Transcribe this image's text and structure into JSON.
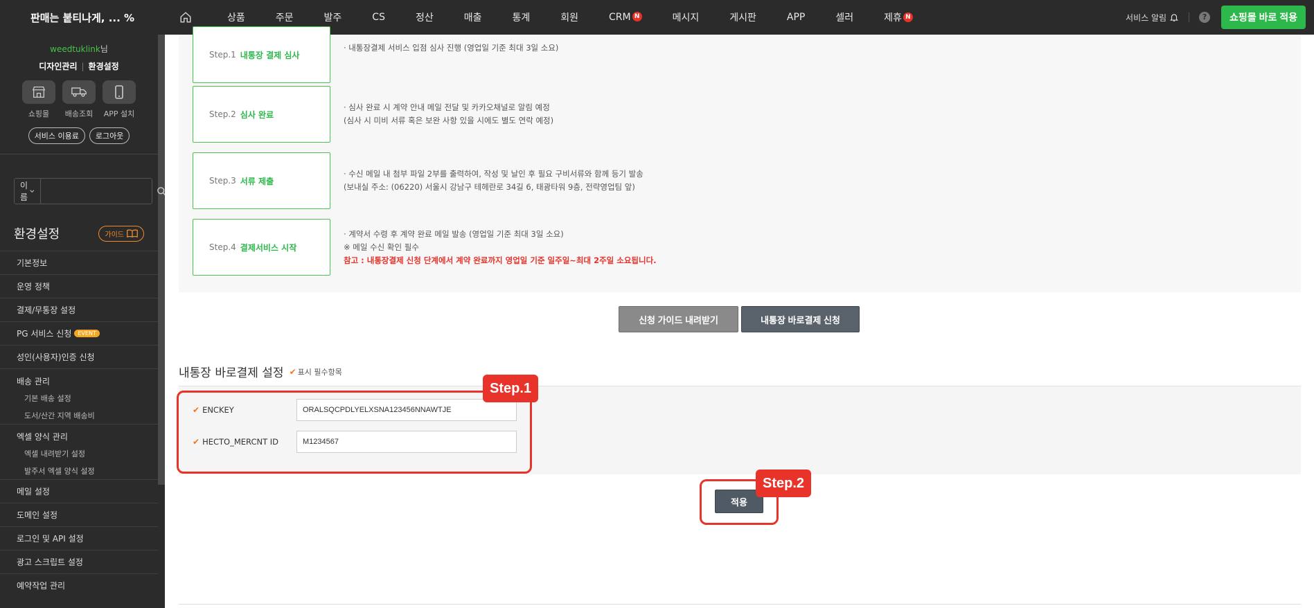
{
  "topbar": {
    "brand": "판매는 붙티나게, ... %",
    "nav": [
      {
        "label": "상품",
        "badge": ""
      },
      {
        "label": "주문",
        "badge": ""
      },
      {
        "label": "발주",
        "badge": ""
      },
      {
        "label": "CS",
        "badge": ""
      },
      {
        "label": "정산",
        "badge": ""
      },
      {
        "label": "매출",
        "badge": ""
      },
      {
        "label": "통계",
        "badge": ""
      },
      {
        "label": "회원",
        "badge": ""
      },
      {
        "label": "CRM",
        "badge": "N"
      },
      {
        "label": "메시지",
        "badge": ""
      },
      {
        "label": "게시판",
        "badge": ""
      },
      {
        "label": "APP",
        "badge": ""
      },
      {
        "label": "셀러",
        "badge": ""
      },
      {
        "label": "제휴",
        "badge": "N"
      }
    ],
    "alarm_label": "서비스 알림",
    "help_label": "?",
    "apply_shop_label": "쇼핑몰 바로 적용"
  },
  "sidebar": {
    "username": "weedtuklink",
    "honorific": "님",
    "links": [
      "디자인관리",
      "환경설정"
    ],
    "quick": [
      {
        "label": "쇼핑몰",
        "icon": "store-icon"
      },
      {
        "label": "배송조회",
        "icon": "truck-icon"
      },
      {
        "label": "APP 설치",
        "icon": "phone-icon"
      }
    ],
    "pills": [
      "서비스 이용료",
      "로그아웃"
    ],
    "search_select": "이름",
    "search_placeholder": "",
    "settings_title": "환경설정",
    "guide_label": "가이드",
    "menu": {
      "basic_info": "기본정보",
      "policy": "운영 정책",
      "payment": "결제/무통장 설정",
      "pg": "PG 서비스 신청",
      "pg_badge": "EVENT",
      "adult": "성인(사용자)인증 신청",
      "delivery": "배송 관리",
      "delivery_basic": "기본 배송 설정",
      "delivery_island": "도서/산간 지역 배송비",
      "excel": "엑셀 양식 관리",
      "excel_download": "엑셀 내려받기 설정",
      "excel_order": "발주서 엑셀 양식 설정",
      "mail": "메일 설정",
      "domain": "도메인 설정",
      "login_api": "로그인 및 API 설정",
      "ad_script": "광고 스크립트 설정",
      "reservation": "예약작업 관리"
    }
  },
  "steps": [
    {
      "num": "Step.1",
      "name": "내통장 결제 심사",
      "desc": [
        "· 내통장결제 서비스 입점 심사 진행 (영업일 기준 최대 3일 소요)"
      ]
    },
    {
      "num": "Step.2",
      "name": "심사 완료",
      "desc": [
        "· 심사 완료 시 계약 안내 메일 전달 및 카카오채널로 알림 예정",
        "(심사 시 미비 서류 혹은 보완 사항 있을 시에도 별도 연락 예정)"
      ]
    },
    {
      "num": "Step.3",
      "name": "서류 제출",
      "desc": [
        "· 수신 메일 내 첨부 파일 2부를 출력하여, 작성 및 날인 후 필요 구비서류와 함께 등기 발송",
        "(보내실 주소: (06220) 서울시 강남구 테헤란로 34길 6, 태광타워 9층, 전략영업팀 앞)"
      ]
    },
    {
      "num": "Step.4",
      "name": "결제서비스 시작",
      "desc": [
        "· 계약서 수령 후 계약 완료 메일 발송 (영업일 기준 최대 3일 소요)",
        "※ 메일 수신 확인 필수"
      ],
      "note": "참고 : 내통장결제 신청 단계에서 계약 완료까지 영업일 기준 일주일~최대 2주일 소요됩니다."
    }
  ],
  "buttons": {
    "guide_download": "신청 가이드 내려받기",
    "apply_request": "내통장 바로결제 신청",
    "apply": "적용"
  },
  "settings_section": {
    "title": "내통장 바로결제 설정",
    "required_note": "표시 필수항목",
    "fields": [
      {
        "label": "ENCKEY",
        "value": "ORALSQCPDLYELXSNA123456NNAWTJE"
      },
      {
        "label": "HECTO_MERCNT ID",
        "value": "M1234567"
      }
    ]
  },
  "annotations": [
    "Step.1",
    "Step.2"
  ],
  "colors": {
    "accent_green": "#2db84b",
    "highlight_red": "#e8332a",
    "topbar_bg": "#2b2b2b"
  }
}
